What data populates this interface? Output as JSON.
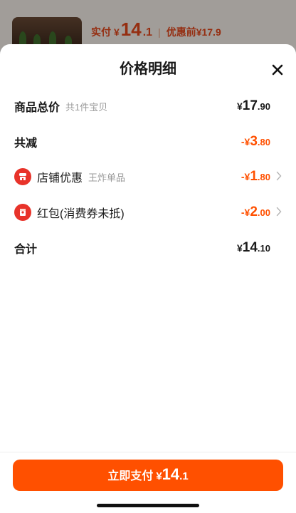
{
  "behind": {
    "actual_label": "实付",
    "currency": "¥",
    "actual_int": "14",
    "actual_dec": ".1",
    "separator": "|",
    "before_discount": "优惠前¥17.9"
  },
  "sheet": {
    "title": "价格明细",
    "close_icon": "close-icon"
  },
  "rows": {
    "total": {
      "label": "商品总价",
      "sub": "共1件宝贝",
      "cur": "¥",
      "int": "17",
      "dec": ".90"
    },
    "reduce": {
      "label": "共减",
      "cur": "-¥",
      "int": "3",
      "dec": ".80"
    },
    "shop": {
      "label": "店铺优惠",
      "sub": "王炸单品",
      "cur": "-¥",
      "int": "1",
      "dec": ".80",
      "icon": "shop-icon"
    },
    "redpacket": {
      "label": "红包(消费券未抵)",
      "cur": "-¥",
      "int": "2",
      "dec": ".00",
      "icon": "red-packet-icon"
    },
    "sum": {
      "label": "合计",
      "cur": "¥",
      "int": "14",
      "dec": ".10"
    }
  },
  "pay_button": {
    "label": "立即支付",
    "cur": "¥",
    "int": "14",
    "dec": ".1"
  },
  "colors": {
    "accent": "#ff5000",
    "badge": "#e8332a",
    "text": "#1a1a1a",
    "muted": "#999999"
  }
}
